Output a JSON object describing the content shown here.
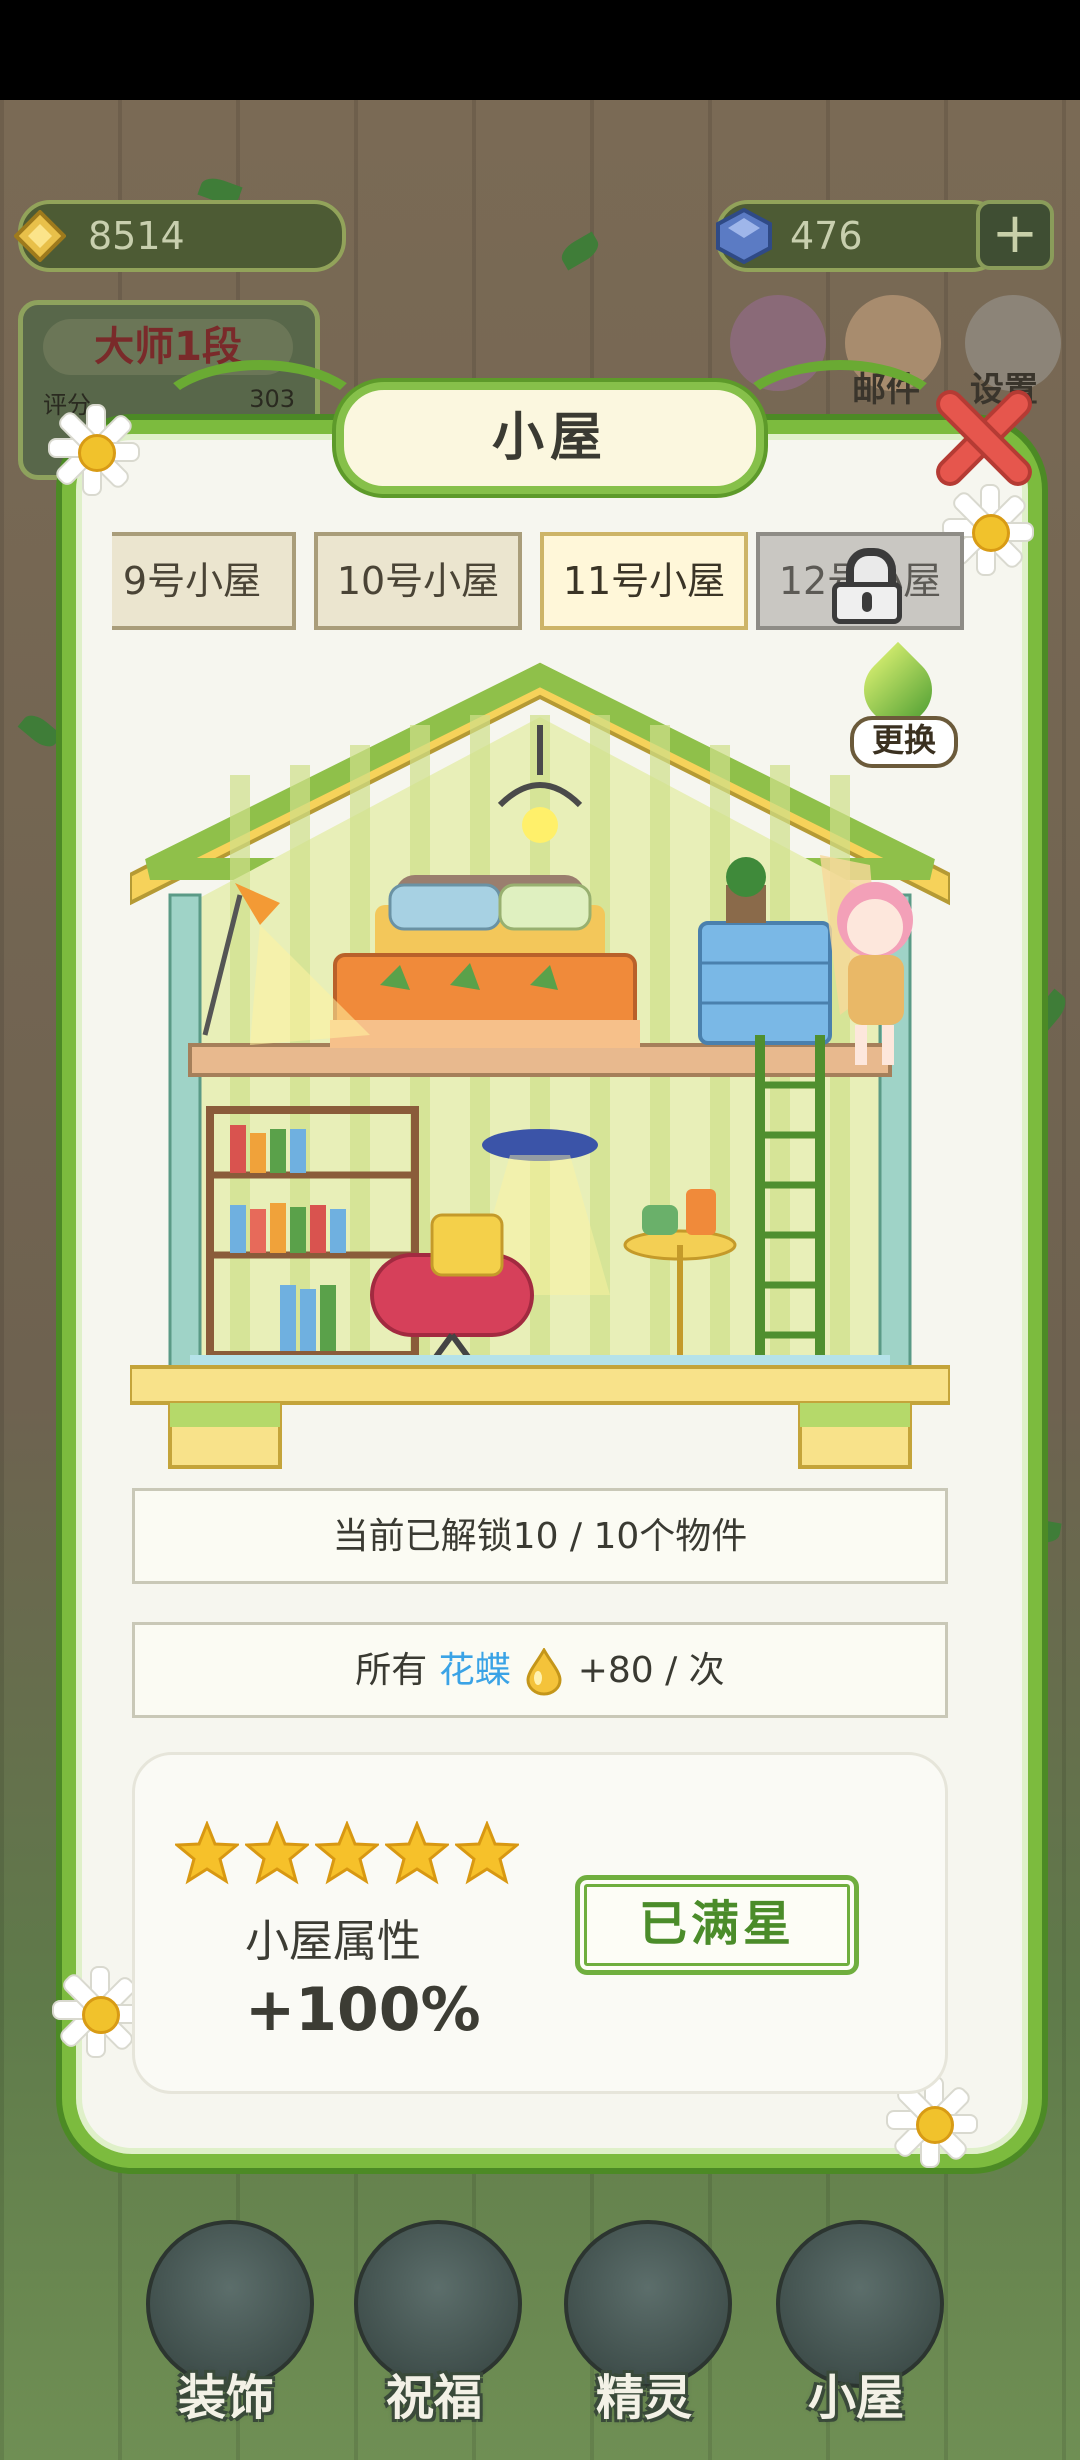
{
  "hud": {
    "coins": "8514",
    "gems": "476",
    "add_gems": "+"
  },
  "rank": {
    "title": "大师1段",
    "label": "评分",
    "score": "303"
  },
  "top_menu": {
    "mail": "邮件",
    "settings": "设置"
  },
  "dialog": {
    "title": "小屋",
    "tabs": [
      {
        "label": "9号小屋",
        "state": "unlocked"
      },
      {
        "label": "10号小屋",
        "state": "unlocked"
      },
      {
        "label": "11号小屋",
        "state": "selected"
      },
      {
        "label": "12号小屋",
        "state": "locked"
      }
    ],
    "change_label": "更换",
    "unlocked_text": "当前已解锁10 / 10个物件",
    "bonus_prefix": "所有",
    "bonus_highlight": "花蝶",
    "bonus_suffix": "+80 / 次",
    "stars": 5,
    "stars_max": 5,
    "attr_label": "小屋属性",
    "attr_value": "+100%",
    "maxed_label": "已满星"
  },
  "bottom_nav": {
    "items": [
      {
        "label": "装饰",
        "icon": "plant-icon"
      },
      {
        "label": "祝福",
        "icon": "butterfly-icon"
      },
      {
        "label": "精灵",
        "icon": "fairy-icon"
      },
      {
        "label": "小屋",
        "icon": "house-icon"
      }
    ]
  },
  "colors": {
    "accent_green": "#7cbb3e",
    "highlight_blue": "#3aa3e6",
    "star_yellow": "#f6c12a",
    "close_red": "#e6564d"
  }
}
